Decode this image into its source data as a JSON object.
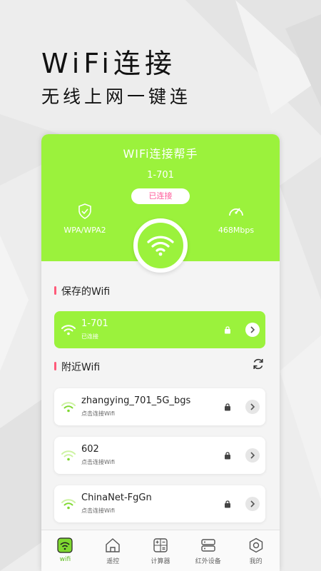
{
  "promo": {
    "headline": "WiFi连接",
    "subline": "无线上网一键连"
  },
  "app": {
    "title": "WIFi连接帮手",
    "current_ssid": "1-701",
    "status": "已连接",
    "security": "WPA/WPA2",
    "speed": "468Mbps"
  },
  "saved": {
    "title": "保存的Wifi",
    "items": [
      {
        "name": "1-701",
        "sub": "已连接"
      }
    ]
  },
  "nearby": {
    "title": "附近Wifi",
    "items": [
      {
        "name": "zhangying_701_5G_bgs",
        "sub": "点击连接Wifi"
      },
      {
        "name": "602",
        "sub": "点击连接Wifi"
      },
      {
        "name": "ChinaNet-FgGn",
        "sub": "点击连接Wifi"
      }
    ]
  },
  "tabs": [
    {
      "label": "wifi",
      "icon": "wifi-tab-icon"
    },
    {
      "label": "遥控",
      "icon": "home-icon"
    },
    {
      "label": "计算器",
      "icon": "calculator-icon"
    },
    {
      "label": "红外设备",
      "icon": "ir-device-icon"
    },
    {
      "label": "我的",
      "icon": "profile-hexagon-icon"
    }
  ],
  "colors": {
    "accent": "#9bf23c",
    "pink": "#ff5a9a",
    "active_tab": "#5bbd1a"
  }
}
